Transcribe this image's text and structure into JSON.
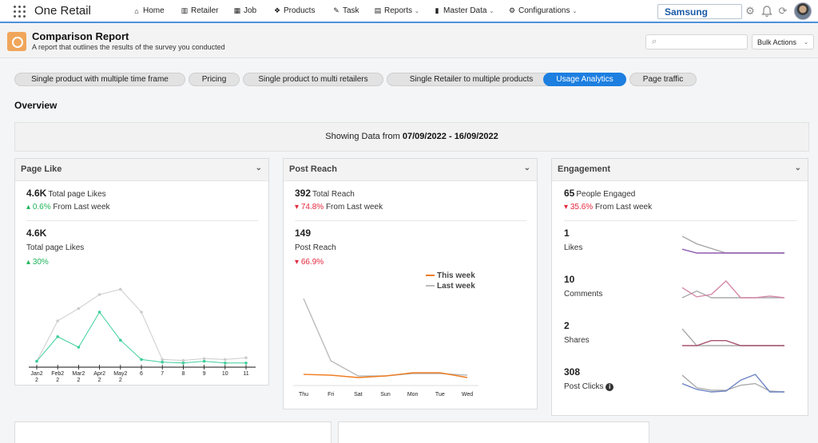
{
  "app": {
    "brand": "One Retail"
  },
  "nav": [
    {
      "label": "Home",
      "icon": "home-icon",
      "glyph": "⌂"
    },
    {
      "label": "Retailer",
      "icon": "bar-chart-icon",
      "glyph": "▥"
    },
    {
      "label": "Job",
      "icon": "building-icon",
      "glyph": "▦"
    },
    {
      "label": "Products",
      "icon": "boxes-icon",
      "glyph": "❖"
    },
    {
      "label": "Task",
      "icon": "edit-icon",
      "glyph": "✎"
    },
    {
      "label": "Reports",
      "icon": "report-icon",
      "glyph": "▤"
    },
    {
      "label": "Master Data",
      "icon": "file-icon",
      "glyph": "▮"
    },
    {
      "label": "Configurations",
      "icon": "gear-icon",
      "glyph": "⚙"
    }
  ],
  "account": {
    "name": "Samsung"
  },
  "header": {
    "title": "Comparison Report",
    "subtitle": "A report that outlines the results of the survey you conducted",
    "search_placeholder": "",
    "bulk_actions": "Bulk Actions"
  },
  "tabs": [
    {
      "label": "Single product with multiple time frame",
      "active": false
    },
    {
      "label": "Pricing",
      "active": false
    },
    {
      "label": "Single product to multi retailers",
      "active": false
    },
    {
      "label": "Single Retailer to multiple products",
      "active": false
    },
    {
      "label": "Usage Analytics",
      "active": true
    },
    {
      "label": "Page traffic",
      "active": false
    }
  ],
  "overview": {
    "title": "Overview"
  },
  "range": {
    "prefix": "Showing Data from",
    "value": "07/09/2022 - 16/09/2022"
  },
  "colors": {
    "accent": "#1d7fe0",
    "up": "#1fb35a",
    "down": "#e3283e",
    "this_week": "#ef7d22",
    "last_week": "#bbbbbb"
  },
  "page_like": {
    "title": "Page Like",
    "total_value": "4.6K",
    "total_label": "Total page Likes",
    "change": "0.6%",
    "change_label": "From Last week",
    "big_value": "4.6K",
    "big_label": "Total page Likes",
    "big_change": "30%"
  },
  "post_reach": {
    "title": "Post Reach",
    "total_value": "392",
    "total_label": "Total Reach",
    "change": "74.8%",
    "change_label": "From Last week",
    "big_value": "149",
    "big_label": "Post Reach",
    "big_change": "66.9%",
    "legend_this": "This week",
    "legend_last": "Last week"
  },
  "engagement": {
    "title": "Engagement",
    "total_value": "65",
    "total_label": "People Engaged",
    "change": "35.6%",
    "change_label": "From Last week",
    "rows": [
      {
        "value": "1",
        "label": "Likes",
        "color": "#8d5bb2"
      },
      {
        "value": "10",
        "label": "Comments",
        "color": "#d58aa9"
      },
      {
        "value": "2",
        "label": "Shares",
        "color": "#a85470"
      },
      {
        "value": "308",
        "label": "Post Clicks",
        "color": "#6f86c4"
      }
    ]
  },
  "chart_data": [
    {
      "type": "line",
      "x": [
        "Jan2 2",
        "Feb2 2",
        "Mar2 2",
        "Apr2 2",
        "May2 2",
        "6",
        "7",
        "8",
        "9",
        "10",
        "11"
      ],
      "series": [
        {
          "values": [
            4,
            32,
            20,
            60,
            28,
            6,
            3,
            2,
            4,
            2,
            2
          ],
          "color": "#3ecf9a"
        },
        {
          "values": [
            4,
            50,
            64,
            80,
            86,
            60,
            6,
            5,
            7,
            6,
            8
          ],
          "color": "#cccccc"
        }
      ],
      "ylim": [
        0,
        100
      ]
    },
    {
      "type": "line",
      "x": [
        "Thu",
        "Fri",
        "Sat",
        "Sun",
        "Mon",
        "Tue",
        "Wed"
      ],
      "series": [
        {
          "name": "This week",
          "values": [
            5,
            4,
            1,
            3,
            7,
            7,
            1
          ],
          "color": "#ef7d22"
        },
        {
          "name": "Last week",
          "values": [
            100,
            22,
            3,
            3,
            6,
            6,
            4
          ],
          "color": "#bbbbbb"
        }
      ],
      "ylim": [
        0,
        105
      ]
    },
    {
      "type": "line",
      "x": [
        1,
        2,
        3,
        4,
        5,
        6,
        7,
        8
      ],
      "series": [
        {
          "values": [
            5,
            0,
            0,
            0,
            0,
            0,
            0,
            0
          ],
          "color": "#8d5bb2"
        },
        {
          "values": [
            22,
            12,
            6,
            0,
            0,
            0,
            0,
            0
          ],
          "color": "#aaaaaa"
        }
      ],
      "ylim": [
        0,
        22
      ]
    },
    {
      "type": "line",
      "x": [
        1,
        2,
        3,
        4,
        5,
        6,
        7,
        8
      ],
      "series": [
        {
          "values": [
            12,
            1,
            4,
            20,
            0,
            0,
            2,
            0
          ],
          "color": "#d58aa9"
        },
        {
          "values": [
            0,
            8,
            0,
            0,
            0,
            0,
            0,
            0
          ],
          "color": "#aaaaaa"
        }
      ],
      "ylim": [
        0,
        20
      ]
    },
    {
      "type": "line",
      "x": [
        1,
        2,
        3,
        4,
        5,
        6,
        7,
        8
      ],
      "series": [
        {
          "values": [
            0,
            0,
            6,
            6,
            0,
            0,
            0,
            0
          ],
          "color": "#a85470"
        },
        {
          "values": [
            20,
            0,
            0,
            0,
            0,
            0,
            0,
            0
          ],
          "color": "#aaaaaa"
        }
      ],
      "ylim": [
        0,
        20
      ]
    },
    {
      "type": "line",
      "x": [
        1,
        2,
        3,
        4,
        5,
        6,
        7,
        8
      ],
      "series": [
        {
          "values": [
            10,
            3,
            0,
            1,
            14,
            21,
            0,
            0
          ],
          "color": "#6f86c4"
        },
        {
          "values": [
            20,
            5,
            2,
            2,
            8,
            10,
            1,
            0
          ],
          "color": "#aaaaaa"
        }
      ],
      "ylim": [
        0,
        22
      ]
    }
  ]
}
